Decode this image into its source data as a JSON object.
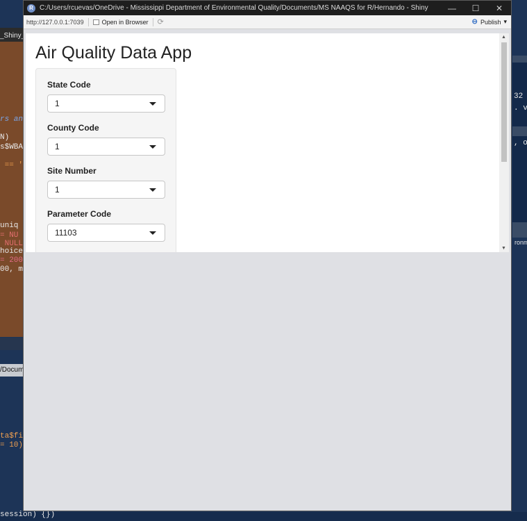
{
  "background": {
    "tab_label": "_Shiny_t",
    "code_lines": [
      "rs an",
      "N)",
      "s$WBA",
      " == '",
      "uniq",
      "= NU",
      " NULL",
      "hoice",
      "= 200",
      "00, m"
    ],
    "right_lines": [
      "32",
      ". va",
      ", o"
    ],
    "console_tab": "/Docum",
    "console_lines": [
      "ta$fi",
      "= 10)"
    ],
    "bottom_line": "session) {})",
    "right_env": "ronm"
  },
  "window": {
    "title": "C:/Users/rcuevas/OneDrive - Mississippi Department of Environmental Quality/Documents/MS NAAQS for R/Hernando - Shiny",
    "app_icon": "R",
    "controls": {
      "minimize": "—",
      "maximize": "☐",
      "close": "✕"
    }
  },
  "toolbar": {
    "url": "http://127.0.0.1:7039",
    "open_in_browser": "Open in Browser",
    "publish": "Publish"
  },
  "app": {
    "title": "Air Quality Data App",
    "fields": [
      {
        "label": "State Code",
        "value": "1"
      },
      {
        "label": "County Code",
        "value": "1"
      },
      {
        "label": "Site Number",
        "value": "1"
      },
      {
        "label": "Parameter Code",
        "value": "11103"
      }
    ]
  }
}
